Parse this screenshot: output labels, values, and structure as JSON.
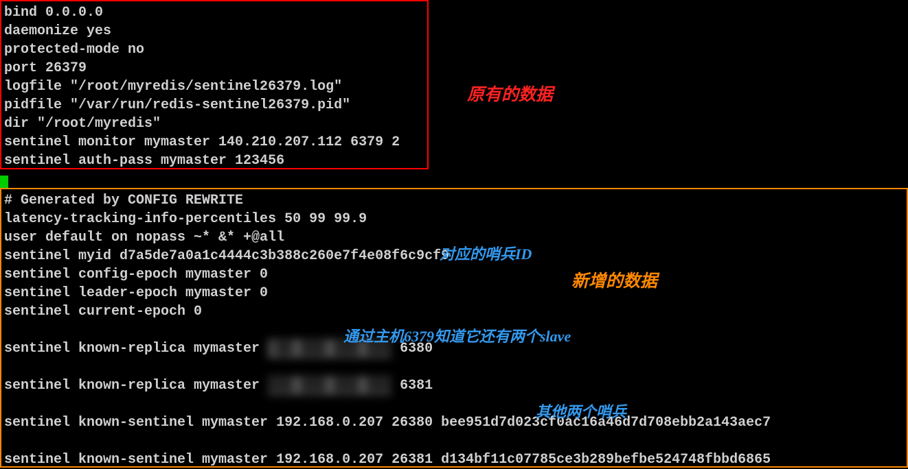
{
  "original_config": {
    "lines": [
      "bind 0.0.0.0",
      "daemonize yes",
      "protected-mode no",
      "port 26379",
      "logfile \"/root/myredis/sentinel26379.log\"",
      "pidfile \"/var/run/redis-sentinel26379.pid\"",
      "dir \"/root/myredis\"",
      "sentinel monitor mymaster 140.210.207.112 6379 2",
      "sentinel auth-pass mymaster 123456"
    ]
  },
  "generated_config": {
    "header": "# Generated by CONFIG REWRITE",
    "lines_top": [
      "latency-tracking-info-percentiles 50 99 99.9",
      "user default on nopass ~* &* +@all",
      "sentinel myid d7a5de7a0a1c4444c3b388c260e7f4e08f6c9cf9",
      "sentinel config-epoch mymaster 0",
      "sentinel leader-epoch mymaster 0",
      "sentinel current-epoch 0"
    ],
    "replica1_prefix": "sentinel known-replica mymaster ",
    "replica1_redacted": "1██.███.███.███",
    "replica1_port": " 6380",
    "replica2_prefix": "sentinel known-replica mymaster ",
    "replica2_redacted": "███.███.███.███",
    "replica2_port": " 6381",
    "sentinel1": "sentinel known-sentinel mymaster 192.168.0.207 26380 bee951d7d023cf0ac16a46d7d708ebb2a143aec7",
    "sentinel2": "sentinel known-sentinel mymaster 192.168.0.207 26381 d134bf11c07785ce3b289befbe524748fbbd6865"
  },
  "annotations": {
    "original_data": "原有的数据",
    "new_data": "新增的数据",
    "sentinel_id": "对应的哨兵ID",
    "slaves_note": "通过主机6379知道它还有两个slave",
    "other_sentinels": "其他两个哨兵"
  }
}
